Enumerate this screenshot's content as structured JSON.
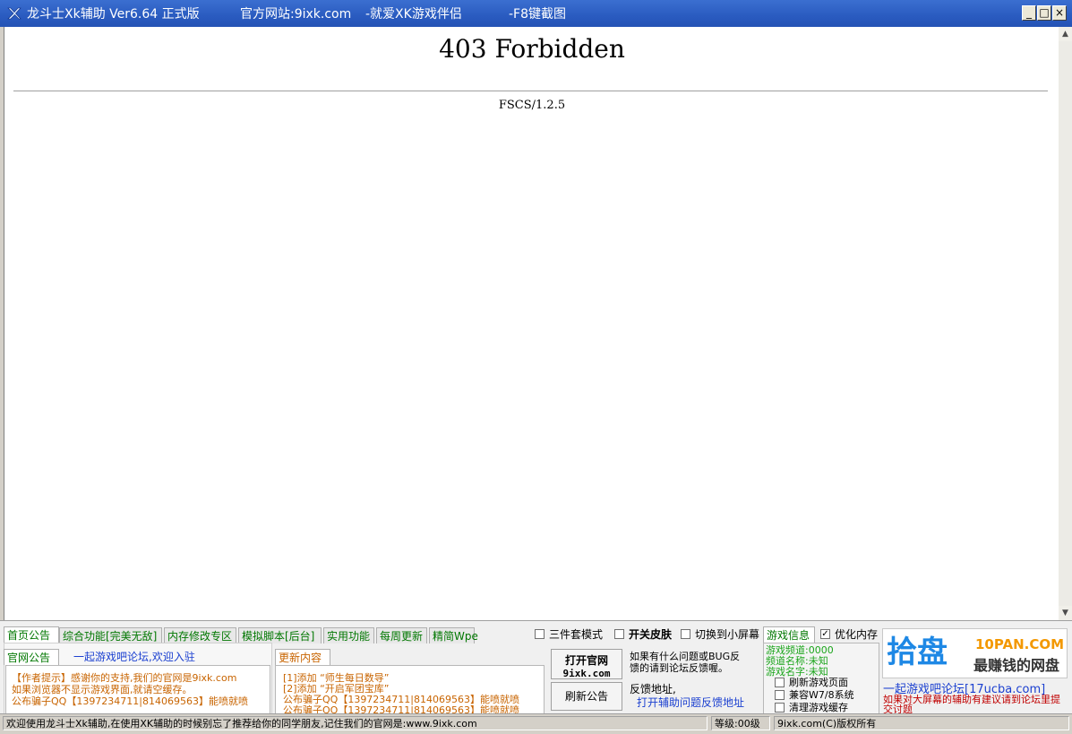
{
  "titlebar": {
    "app_name": "龙斗士Xk辅助 Ver6.64 正式版",
    "site": "官方网站:9ixk.com",
    "slogan": "-就爱XK游戏伴侣",
    "hotkey": "-F8键截图",
    "minimize": "_",
    "maximize": "□",
    "close": "×"
  },
  "browser": {
    "error_title": "403 Forbidden",
    "error_server": "FSCS/1.2.5"
  },
  "tabs": [
    "首页公告",
    "综合功能[完美无敌]",
    "内存修改专区",
    "模拟脚本[后台]",
    "实用功能",
    "每周更新",
    "精简Wpe"
  ],
  "options": {
    "three_piece": "三件套模式",
    "skin_switch": "开关皮肤",
    "small_screen": "切换到小屏幕"
  },
  "notice": {
    "tab_label": "官网公告",
    "forum_link": "一起游戏吧论坛,欢迎入驻",
    "lines": [
      "【作者提示】感谢你的支持,我们的官网是9ixk.com",
      "如果浏览器不显示游戏界面,就请空缓存。",
      "公布骗子QQ【1397234711|814069563】能喷就喷"
    ]
  },
  "updates": {
    "tab_label": "更新内容",
    "lines": [
      "[1]添加 “师生每日数导”",
      "[2]添加 “开启军团宝库”",
      "公布骗子QQ【1397234711|814069563】能喷就喷",
      "公布骗子QQ【1397234711|814069563】能喷就喷"
    ]
  },
  "buttons": {
    "open_site_line1": "打开官网",
    "open_site_line2": "9ixk.com",
    "refresh_notice": "刷新公告"
  },
  "feedback": {
    "text_line1": "如果有什么问题或BUG反",
    "text_line2": "馈的请到论坛反馈喔。",
    "address_label": "反馈地址,",
    "link": "打开辅助问题反馈地址"
  },
  "game_info": {
    "tab_label": "游戏信息",
    "optimize_memory": "优化内存",
    "channel": "游戏频道:0000",
    "channel_name": "频道名称:未知",
    "game_name": "游戏名字:未知",
    "refresh_page": "刷新游戏页面",
    "compat_win": "兼容W7/8系统",
    "clear_cache": "清理游戏缓存"
  },
  "ad": {
    "logo_cn": "拾盘",
    "brand": "10PAN.COM",
    "tagline": "最赚钱的网盘",
    "forum_link": "一起游戏吧论坛[17ucba.com]",
    "note": "如果对大屏幕的辅助有建议请到论坛里提交讨题"
  },
  "status": {
    "welcome": "欢迎使用龙斗士Xk辅助,在使用XK辅助的时候别忘了推荐给你的同学朋友,记住我们的官网是:www.9ixk.com",
    "level": "等级:00级",
    "copyright": "9ixk.com(C)版权所有"
  }
}
